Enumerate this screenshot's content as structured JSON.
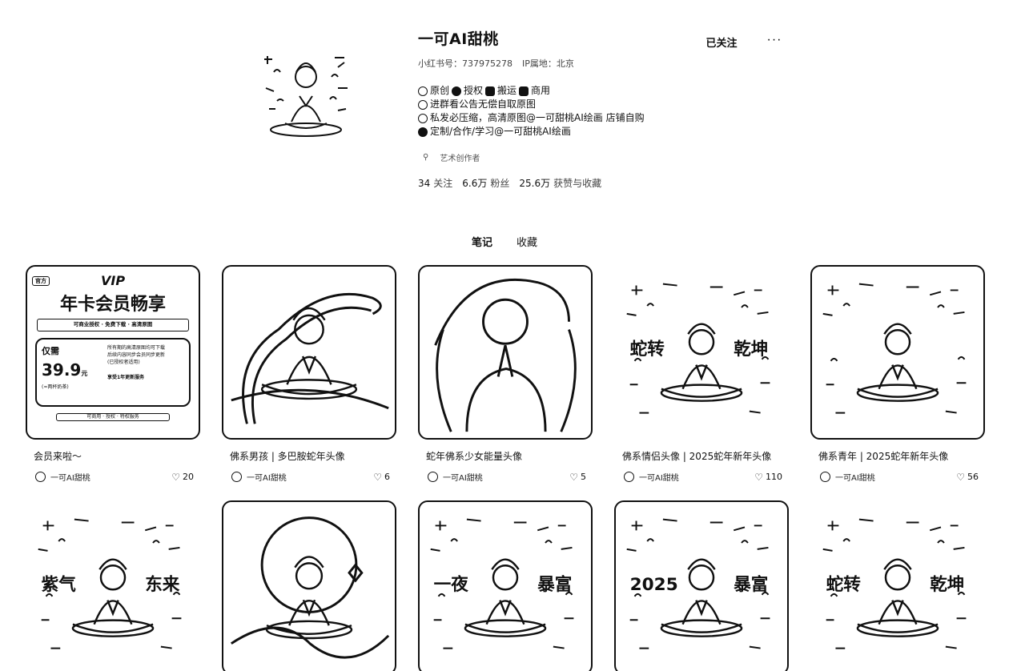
{
  "profile": {
    "name": "一可AI甜桃",
    "id_label": "小红书号：",
    "id_value": "737975278",
    "ip_label": "IP属地：",
    "ip_value": "北京",
    "follow_button": "已关注",
    "more_button": "···",
    "bio": [
      {
        "icon": "puzzle-icon",
        "parts": [
          "原创",
          "授权",
          "搬运",
          "商用"
        ]
      },
      {
        "icon": "bulb-icon",
        "text": "进群看公告无偿自取原图"
      },
      {
        "icon": "sparkle-icon",
        "text": "私发必压缩，高清原图@一可甜桃AI绘画 店铺自购"
      },
      {
        "icon": "chat-icon",
        "text": "定制/合作/学习@一可甜桃AI绘画"
      }
    ],
    "tag": "艺术创作者",
    "stats": [
      {
        "value": "34",
        "label": "关注"
      },
      {
        "value": "6.6万",
        "label": "粉丝"
      },
      {
        "value": "25.6万",
        "label": "获赞与收藏"
      }
    ]
  },
  "tabs": [
    {
      "label": "笔记",
      "active": true
    },
    {
      "label": "收藏",
      "active": false
    }
  ],
  "vip_card": {
    "badge": "官方",
    "vip": "VIP",
    "headline": "年卡会员畅享",
    "bar": "可商业授权 · 免费下载 · 高清原图",
    "only": "仅需",
    "price": "39.9",
    "unit": "元",
    "price_note": "(≈两杯奶茶)",
    "r1": "所有期的高清原图均可下载",
    "r2": "后续内容同步会员同步更新",
    "r3": "(已授权者适用)",
    "r4": "享受1年更新服务",
    "foot": "可商用 · 授权 · 特权服务"
  },
  "notes": [
    {
      "title": "会员来啦～",
      "author": "一可AI甜桃",
      "likes": "20",
      "art": "vip",
      "border": true
    },
    {
      "title": "佛系男孩 | 多巴胺蛇年头像",
      "author": "一可AI甜桃",
      "likes": "6",
      "art": "snake",
      "border": true
    },
    {
      "title": "蛇年佛系少女能量头像",
      "author": "一可AI甜桃",
      "likes": "5",
      "art": "praying",
      "border": true
    },
    {
      "title": "佛系情侣头像 | 2025蛇年新年头像",
      "author": "一可AI甜桃",
      "likes": "110",
      "art": "meditate-text",
      "border": false
    },
    {
      "title": "佛系青年 | 2025蛇年新年头像",
      "author": "一可AI甜桃",
      "likes": "56",
      "art": "meditate-sketch",
      "border": true
    },
    {
      "title": "",
      "author": "",
      "likes": "",
      "art": "meditate-text2",
      "border": false
    },
    {
      "title": "",
      "author": "",
      "likes": "",
      "art": "boy-halo",
      "border": true
    },
    {
      "title": "",
      "author": "",
      "likes": "",
      "art": "girl-text",
      "border": true
    },
    {
      "title": "",
      "author": "",
      "likes": "",
      "art": "girl-text3",
      "border": true
    },
    {
      "title": "",
      "author": "",
      "likes": "",
      "art": "meditate-text4",
      "border": false
    }
  ],
  "art_text": {
    "meditate-text": [
      "蛇转",
      "乾坤"
    ],
    "meditate-text2": [
      "紫气",
      "东来"
    ],
    "girl-text": [
      "一夜",
      "暴富"
    ],
    "girl-text3": [
      "2025",
      "暴富"
    ],
    "meditate-text4": [
      "蛇转",
      "乾坤"
    ]
  }
}
